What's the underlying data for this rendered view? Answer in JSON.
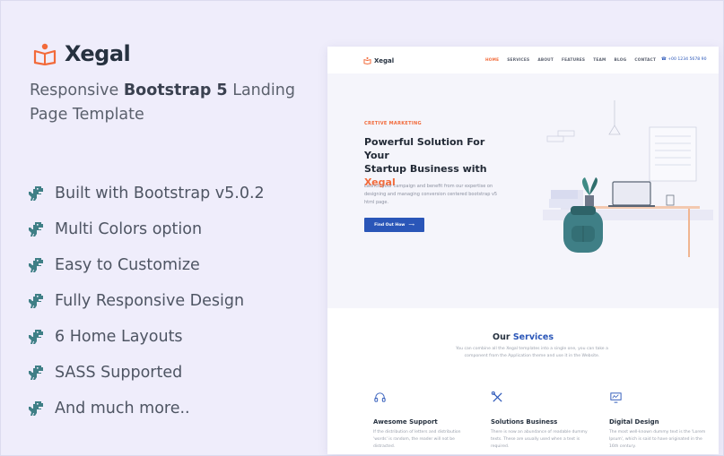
{
  "brand": {
    "name": "Xegal",
    "icon": "open-book-icon",
    "accent": "#f26a3a"
  },
  "tagline": {
    "pre": "Responsive ",
    "bold": "Bootstrap 5",
    "post": " Landing Page Template"
  },
  "features": [
    "Built with Bootstrap v5.0.2",
    "Multi Colors option",
    "Easy to Customize",
    "Fully Responsive Design",
    "6 Home Layouts",
    "SASS Supported",
    "And much more.."
  ],
  "feature_icon": "dinosaur-icon",
  "preview": {
    "brand": "Xegal",
    "menu": [
      "HOME",
      "SERVICES",
      "ABOUT",
      "FEATURES",
      "TEAM",
      "BLOG",
      "CONTACT"
    ],
    "phone": "+00 1234 5678 90",
    "hero": {
      "eyebrow": "CRETIVE MARKETING",
      "title_line1": "Powerful Solution For Your",
      "title_line2": "Startup Business with",
      "title_accent": "Xegal",
      "description": "Launch your campaign and benefit from our expertise on designing and managing conversion centered bootstrap v5 html page.",
      "button": "Find Out How"
    },
    "services": {
      "title_pre": "Our ",
      "title_accent": "Services",
      "subtitle": "You can combine all the Xegal templates into a single one, you can take a component from the Application theme and use it in the Website.",
      "items": [
        {
          "icon": "headset-icon",
          "name": "Awesome Support",
          "desc": "If the distribution of letters and distribution 'words' is random, the reader will not be distracted."
        },
        {
          "icon": "tools-icon",
          "name": "Solutions Business",
          "desc": "There is now an abundance of readable dummy texts. These are usually used when a text is required."
        },
        {
          "icon": "monitor-icon",
          "name": "Digital Design",
          "desc": "The most well-known dummy text is the 'Lorem Ipsum', which is said to have originated in the 16th century."
        }
      ]
    }
  },
  "colors": {
    "background": "#efedfb",
    "primary": "#2a56b8",
    "accent": "#f26a3a",
    "teal": "#3f7f86"
  }
}
